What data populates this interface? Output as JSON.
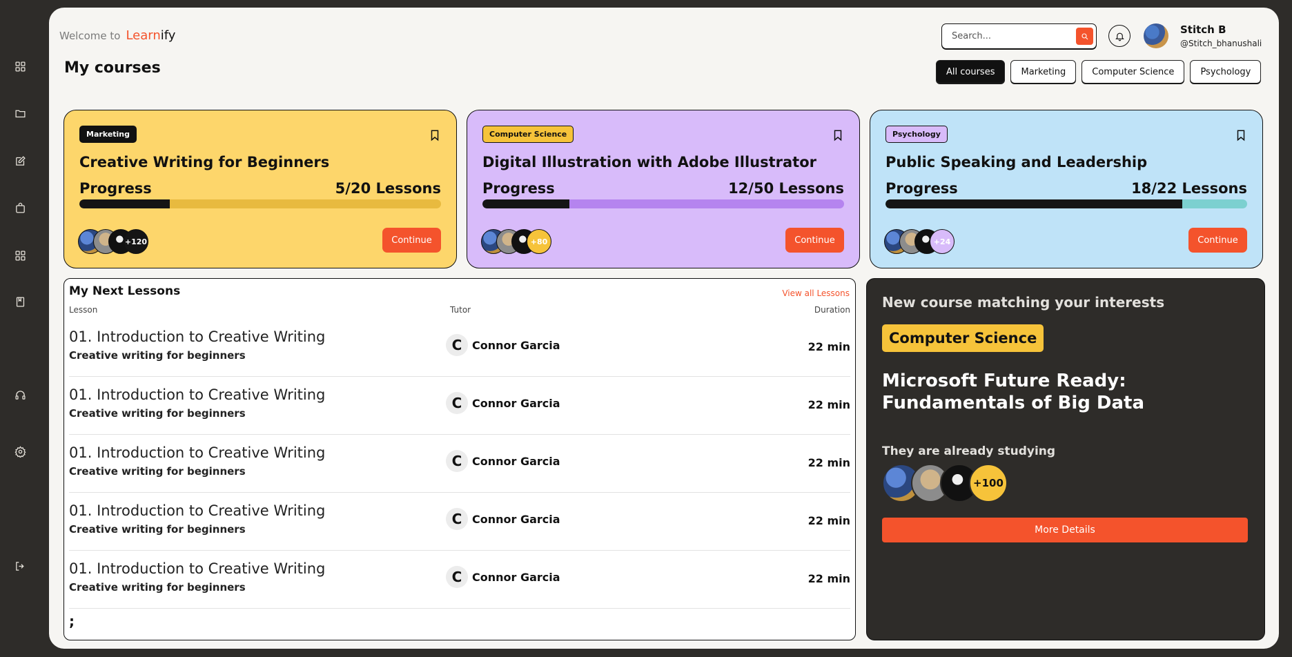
{
  "brand": {
    "welcome": "Welcome to",
    "name_part1": "Learn",
    "name_part2": "ify"
  },
  "page_title": "My courses",
  "search": {
    "placeholder": "Search..."
  },
  "user": {
    "name": "Stitch B",
    "handle": "@Stitch_bhanushali"
  },
  "filters": [
    "All courses",
    "Marketing",
    "Computer Science",
    "Psychology"
  ],
  "sidebar": {
    "icons": [
      "dashboard-icon",
      "folder-icon",
      "edit-icon",
      "bag-icon",
      "apps-icon",
      "book-icon",
      "headphones-icon",
      "settings-icon",
      "logout-icon"
    ]
  },
  "courses": [
    {
      "tag": "Marketing",
      "title": "Creative Writing for Beginners",
      "progress_label": "Progress",
      "lessons": "5/20 Lessons",
      "progress": 0.25,
      "students": "+120",
      "cta": "Continue",
      "bg": "#fdd66b",
      "bar_bg": "#e8ba3f",
      "tag_bg": "#111111",
      "tag_color": "#ffffff",
      "count_bg": "#151515",
      "count_color": "#ffffff"
    },
    {
      "tag": "Computer Science",
      "title": "Digital Illustration with Adobe Illustrator",
      "progress_label": "Progress",
      "lessons": "12/50 Lessons",
      "progress": 0.24,
      "students": "+80",
      "cta": "Continue",
      "bg": "#d8bbfa",
      "bar_bg": "#b584ef",
      "tag_bg": "#f6c33a",
      "tag_color": "#111111",
      "count_bg": "#f6c33a",
      "count_color": "#ffffff"
    },
    {
      "tag": "Psychology",
      "title": "Public Speaking and Leadership",
      "progress_label": "Progress",
      "lessons": "18/22 Lessons",
      "progress": 0.82,
      "students": "+24",
      "cta": "Continue",
      "bg": "#bfe3f8",
      "bar_bg": "#7cd0d0",
      "tag_bg": "#d8bbfa",
      "tag_color": "#111111",
      "count_bg": "#d8bbfa",
      "count_color": "#ffffff"
    }
  ],
  "lessons": {
    "title": "My Next Lessons",
    "view_all": "View all Lessons",
    "headers": {
      "lesson": "Lesson",
      "tutor": "Tutor",
      "duration": "Duration"
    },
    "rows": [
      {
        "title": "01. Introduction to Creative Writing",
        "subtitle": "Creative writing for beginners",
        "tutor_initial": "C",
        "tutor": "Connor Garcia",
        "duration": "22 min"
      },
      {
        "title": "01. Introduction to Creative Writing",
        "subtitle": "Creative writing for beginners",
        "tutor_initial": "C",
        "tutor": "Connor Garcia",
        "duration": "22 min"
      },
      {
        "title": "01. Introduction to Creative Writing",
        "subtitle": "Creative writing for beginners",
        "tutor_initial": "C",
        "tutor": "Connor Garcia",
        "duration": "22 min"
      },
      {
        "title": "01. Introduction to Creative Writing",
        "subtitle": "Creative writing for beginners",
        "tutor_initial": "C",
        "tutor": "Connor Garcia",
        "duration": "22 min"
      },
      {
        "title": "01. Introduction to Creative Writing",
        "subtitle": "Creative writing for beginners",
        "tutor_initial": "C",
        "tutor": "Connor Garcia",
        "duration": "22 min"
      }
    ],
    "trailing_text": ";"
  },
  "promo": {
    "heading": "New course matching your interests",
    "tag": "Computer Science",
    "title": "Microsoft Future Ready: Fundamentals of Big Data",
    "studying_label": "They are already studying",
    "students": "+100",
    "cta": "More Details"
  },
  "colors": {
    "accent": "#f4532c",
    "dark": "#2e2c29",
    "yellow": "#f6c33a"
  }
}
